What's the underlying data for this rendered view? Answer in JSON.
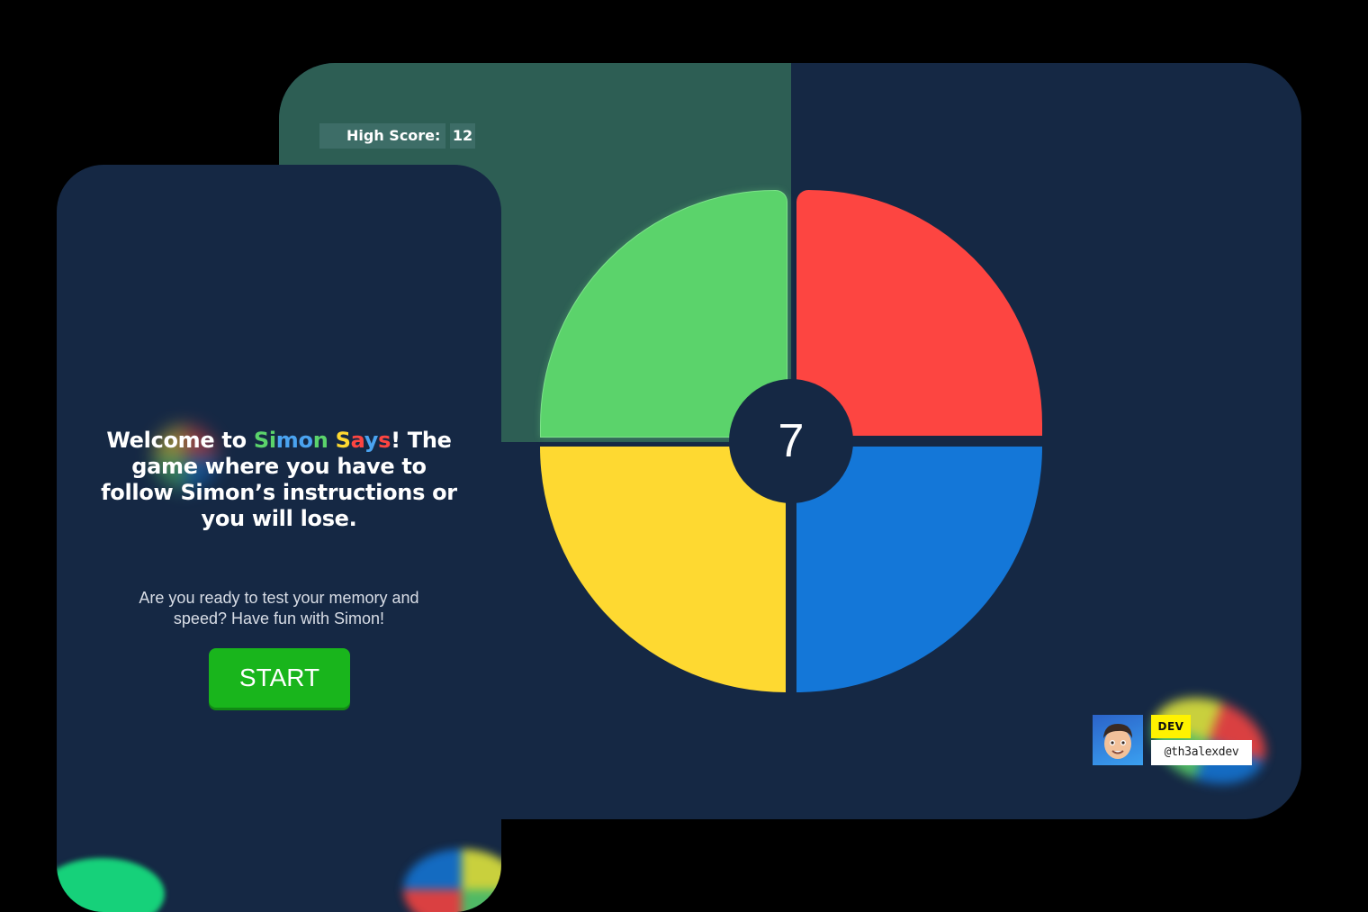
{
  "desktop": {
    "high_score_label": "High Score:",
    "high_score_value": "12",
    "round_count": "7",
    "pad_colors": {
      "green": "#5bd36b",
      "red": "#fd4541",
      "yellow": "#fed931",
      "blue": "#1477d8"
    }
  },
  "badge": {
    "tag": "DEV",
    "handle": "@th3alexdev"
  },
  "mobile": {
    "welcome_prefix": "Welcome to",
    "welcome_brand_letters": [
      {
        "char": "S",
        "color": "#5bd36b"
      },
      {
        "char": "i",
        "color": "#5bd36b"
      },
      {
        "char": "m",
        "color": "#4aa3f0"
      },
      {
        "char": "o",
        "color": "#4aa3f0"
      },
      {
        "char": "n",
        "color": "#5bd36b"
      },
      {
        "char": " ",
        "color": "#ffffff"
      },
      {
        "char": "S",
        "color": "#fed931"
      },
      {
        "char": "a",
        "color": "#fd4541"
      },
      {
        "char": "y",
        "color": "#4aa3f0"
      },
      {
        "char": "s",
        "color": "#fd4541"
      }
    ],
    "welcome_suffix": "! The game where you have to follow Simon’s instructions or you will lose.",
    "ready_text": "Are you ready to test your memory and speed? Have fun with Simon!",
    "start_label": "START"
  },
  "colors": {
    "background": "#000000",
    "card": "#152844",
    "panel": "#2d5e54",
    "start_button": "#19b51c"
  }
}
